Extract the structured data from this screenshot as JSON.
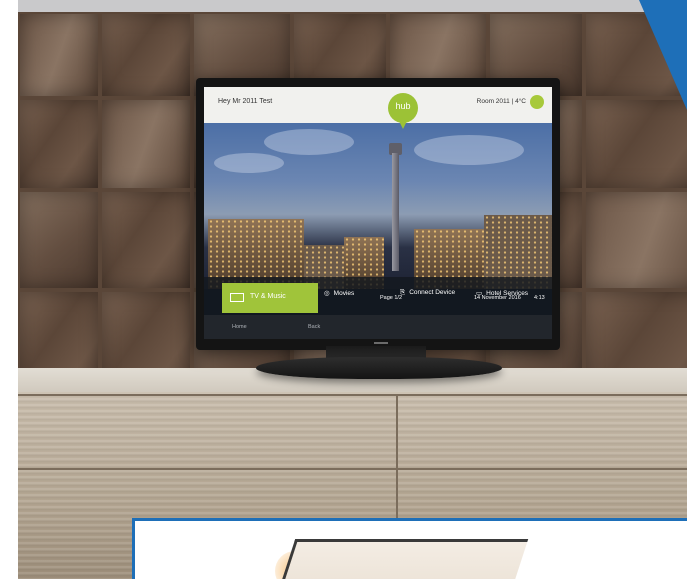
{
  "scene": {
    "description": "Hotel TV mounted on wooden wall above light wood cabinet"
  },
  "tv": {
    "header": {
      "greeting": "Hey Mr 2011 Test",
      "room_info": "Room 2011 | 4°C",
      "hub_logo": "hub"
    },
    "menu": {
      "active_item": "TV & Music",
      "items": [
        {
          "label": "Movies",
          "icon": "movie-reel-icon"
        },
        {
          "label": "Connect Device",
          "icon": "connect-device-icon"
        },
        {
          "label": "Hotel Services",
          "icon": "bed-icon"
        }
      ]
    },
    "footer": {
      "home_label": "Home",
      "back_label": "Back",
      "page_label": "Page 1/2",
      "date_label": "14 November 2016",
      "time_label": "4:13"
    }
  },
  "colors": {
    "accent_green": "#a0c43a",
    "corner_blue": "#1e6fb8",
    "wall_wood": "#5a4638",
    "cabinet_wood": "#b3a591"
  }
}
